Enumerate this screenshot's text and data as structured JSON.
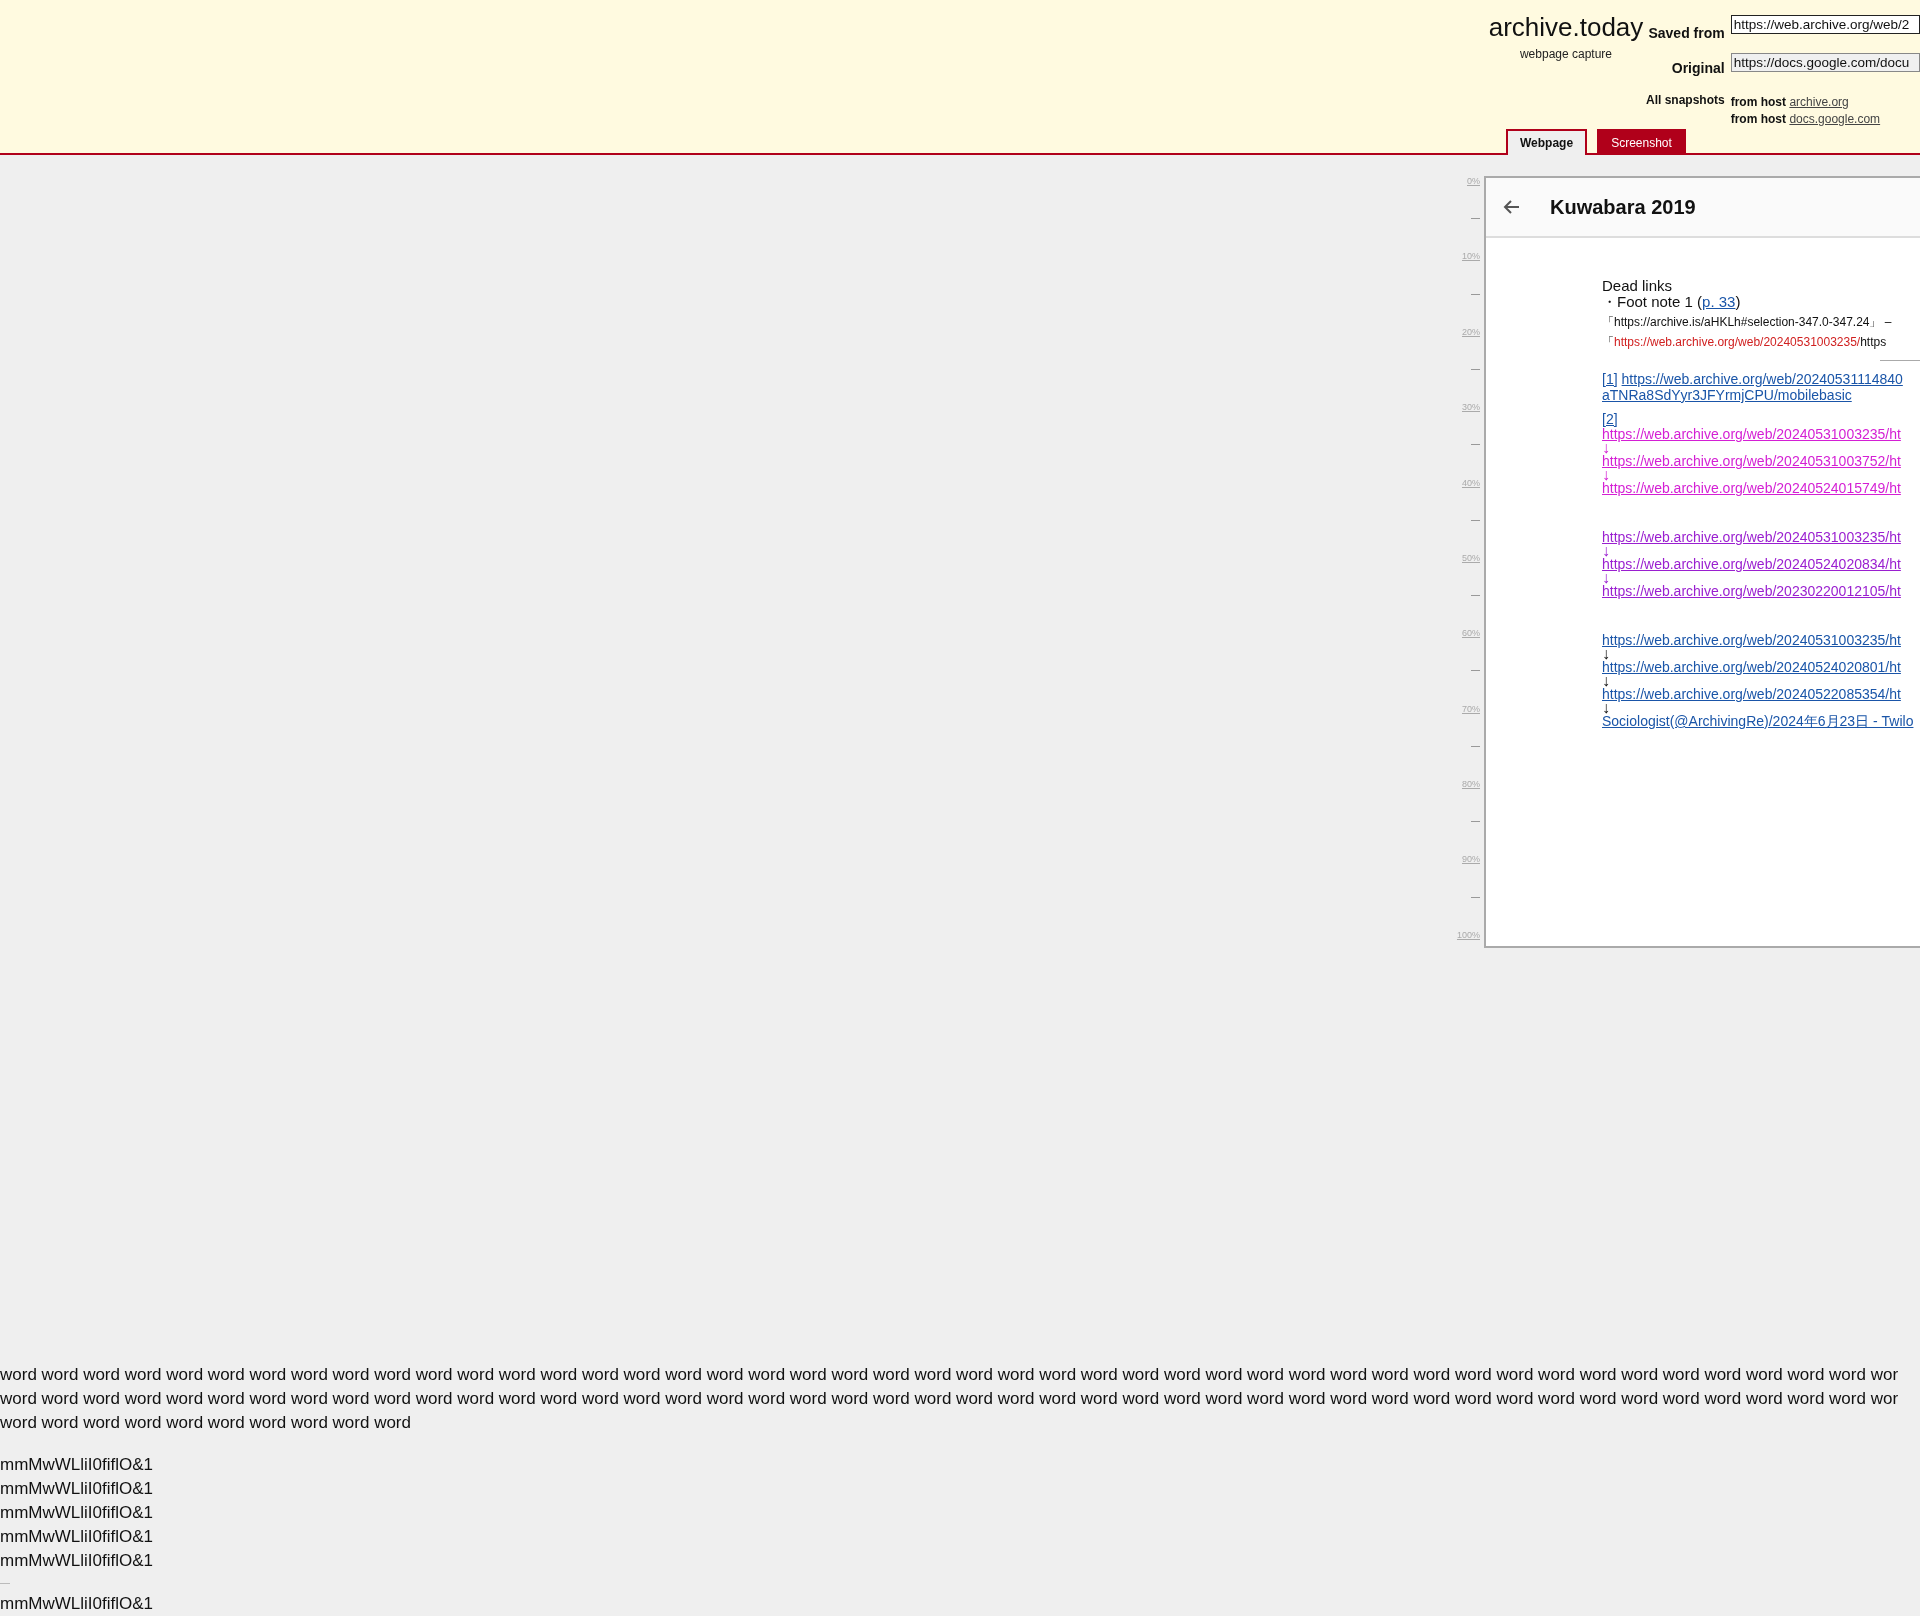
{
  "header": {
    "logo": "archive.today",
    "tagline": "webpage capture",
    "saved_from": {
      "label": "Saved from",
      "value": "https://web.archive.org/web/2"
    },
    "original": {
      "label": "Original",
      "value": "https://docs.google.com/docu"
    },
    "all_snapshots": {
      "label": "All snapshots",
      "hosts": [
        {
          "prefix": "from host",
          "link": "archive.org"
        },
        {
          "prefix": "from host",
          "link": "docs.google.com"
        }
      ]
    }
  },
  "tabs": [
    {
      "label": "Webpage",
      "selected": true
    },
    {
      "label": "Screenshot",
      "selected": false
    }
  ],
  "ruler": [
    "0%",
    "10%",
    "20%",
    "30%",
    "40%",
    "50%",
    "60%",
    "70%",
    "80%",
    "90%",
    "100%"
  ],
  "document": {
    "title": "Kuwabara 2019",
    "heading": "Dead links",
    "footnote": {
      "text": "・Foot note 1 (",
      "link": "p. 33",
      "after": ")"
    },
    "quote": "「https://archive.is/aHKLh#selection-347.0-347.24」 –",
    "archived": {
      "prefix": "「",
      "highlight": "https://web.archive.org/web/20240531003235/",
      "suffix": "https"
    },
    "ref1": {
      "marker": "[1]",
      "url": "https://web.archive.org/web/20240531114840",
      "url_cont": "aTNRa8SdYyr3JFYrmjCPU/mobilebasic"
    },
    "ref2_marker": "[2]",
    "chains": [
      {
        "color": "#d41fd4",
        "items": [
          {
            "kind": "link",
            "text": "https://web.archive.org/web/20240531003235/ht"
          },
          {
            "kind": "arrow",
            "text": "↓"
          },
          {
            "kind": "link",
            "text": "https://web.archive.org/web/20240531003752/ht"
          },
          {
            "kind": "arrow",
            "text": "↓"
          },
          {
            "kind": "link",
            "text": "https://web.archive.org/web/20240524015749/ht"
          }
        ]
      },
      {
        "color": "#9a1fd0",
        "items": [
          {
            "kind": "link",
            "text": "https://web.archive.org/web/20240531003235/ht"
          },
          {
            "kind": "arrow",
            "text": "↓"
          },
          {
            "kind": "link",
            "text": "https://web.archive.org/web/20240524020834/ht"
          },
          {
            "kind": "arrow",
            "text": "↓"
          },
          {
            "kind": "link",
            "text": "https://web.archive.org/web/20230220012105/ht"
          }
        ]
      },
      {
        "color": "#1a55a8",
        "items": [
          {
            "kind": "link",
            "text": "https://web.archive.org/web/20240531003235/ht"
          },
          {
            "kind": "arrow",
            "text": "↓"
          },
          {
            "kind": "link",
            "text": "https://web.archive.org/web/20240524020801/ht"
          },
          {
            "kind": "arrow",
            "text": "↓"
          },
          {
            "kind": "link",
            "text": "https://web.archive.org/web/20240522085354/ht"
          },
          {
            "kind": "arrow",
            "text": "↓"
          },
          {
            "kind": "link",
            "text": "Sociologist(@ArchivingRe)/2024年6月23日 - Twilo"
          }
        ]
      }
    ]
  },
  "filler": {
    "lines": [
      "word word word word word word word word word word word word word word word word word word word word word word word word word word word word word word word word word word word word word word word word word word word word word wor",
      "word word word word word word word word word word word word word word word word word word word word word word word word word word word word word word word word word word word word word word word word word word word word word wor",
      "word word word word word word word word word word"
    ],
    "samples": [
      "mmMwWLliI0fiflO&1",
      "mmMwWLliI0fiflO&1",
      "mmMwWLliI0fiflO&1",
      "mmMwWLliI0fiflO&1",
      "mmMwWLliI0fiflO&1"
    ],
    "samples_after_rule": [
      "mmMwWLliI0fiflO&1"
    ]
  }
}
